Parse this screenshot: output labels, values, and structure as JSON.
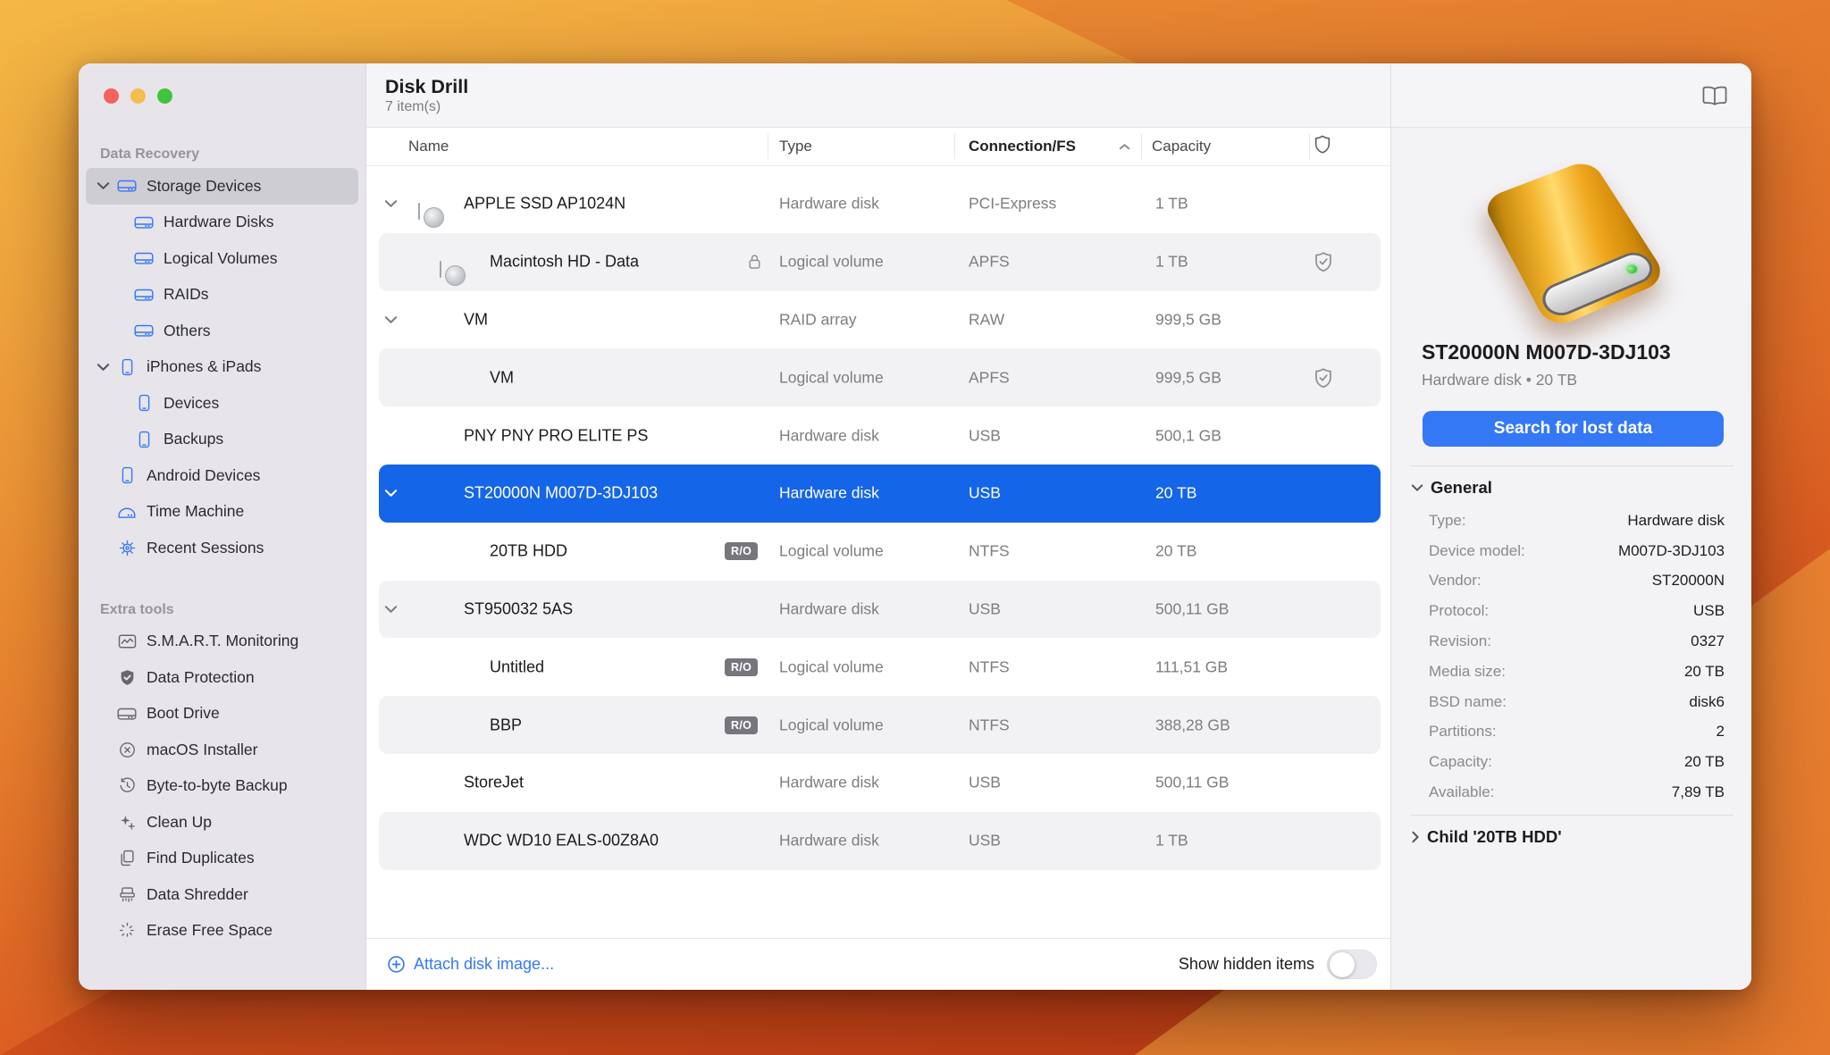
{
  "window": {
    "title": "Disk Drill",
    "subtitle": "7 item(s)"
  },
  "sidebar": {
    "sections": [
      {
        "label": "Data Recovery",
        "tone": "blue",
        "items": [
          {
            "label": "Storage Devices",
            "icon": "drive",
            "level": 0,
            "chevron": true,
            "selected": true
          },
          {
            "label": "Hardware Disks",
            "icon": "drive",
            "level": 1
          },
          {
            "label": "Logical Volumes",
            "icon": "drive",
            "level": 1
          },
          {
            "label": "RAIDs",
            "icon": "drive",
            "level": 1
          },
          {
            "label": "Others",
            "icon": "drive",
            "level": 1
          },
          {
            "label": "iPhones & iPads",
            "icon": "iphone",
            "level": 0,
            "chevron": true
          },
          {
            "label": "Devices",
            "icon": "iphone",
            "level": 1
          },
          {
            "label": "Backups",
            "icon": "iphone",
            "level": 1
          },
          {
            "label": "Android Devices",
            "icon": "iphone",
            "level": 0
          },
          {
            "label": "Time Machine",
            "icon": "timemachine",
            "level": 0
          },
          {
            "label": "Recent Sessions",
            "icon": "gear",
            "level": 0
          }
        ]
      },
      {
        "label": "Extra tools",
        "tone": "gray",
        "items": [
          {
            "label": "S.M.A.R.T. Monitoring",
            "icon": "smart",
            "level": 0
          },
          {
            "label": "Data Protection",
            "icon": "shield-filled",
            "level": 0
          },
          {
            "label": "Boot Drive",
            "icon": "drive",
            "level": 0
          },
          {
            "label": "macOS Installer",
            "icon": "circle-x",
            "level": 0
          },
          {
            "label": "Byte-to-byte Backup",
            "icon": "history",
            "level": 0
          },
          {
            "label": "Clean Up",
            "icon": "sparkle",
            "level": 0
          },
          {
            "label": "Find Duplicates",
            "icon": "duplicates",
            "level": 0
          },
          {
            "label": "Data Shredder",
            "icon": "shredder",
            "level": 0
          },
          {
            "label": "Erase Free Space",
            "icon": "erase",
            "level": 0
          }
        ]
      }
    ]
  },
  "table": {
    "columns": [
      "Name",
      "Type",
      "Connection/FS",
      "Capacity"
    ],
    "sort": {
      "column": "Connection/FS",
      "direction": "asc"
    },
    "rows": [
      {
        "name": "APPLE SSD AP1024N",
        "type": "Hardware disk",
        "connection": "PCI-Express",
        "capacity": "1 TB",
        "icon": "internal",
        "level": 0,
        "chevron": true
      },
      {
        "name": "Macintosh HD - Data",
        "type": "Logical volume",
        "connection": "APFS",
        "capacity": "1 TB",
        "icon": "internal",
        "level": 1,
        "lock": true,
        "shield": true
      },
      {
        "name": "VM",
        "type": "RAID array",
        "connection": "RAW",
        "capacity": "999,5 GB",
        "icon": "external",
        "level": 0,
        "chevron": true
      },
      {
        "name": "VM",
        "type": "Logical volume",
        "connection": "APFS",
        "capacity": "999,5 GB",
        "icon": "external",
        "level": 1,
        "shield": true
      },
      {
        "name": "PNY PNY PRO ELITE PS",
        "type": "Hardware disk",
        "connection": "USB",
        "capacity": "500,1 GB",
        "icon": "external",
        "level": 0
      },
      {
        "name": "ST20000N M007D-3DJ103",
        "type": "Hardware disk",
        "connection": "USB",
        "capacity": "20 TB",
        "icon": "external",
        "level": 0,
        "chevron": true,
        "selected": true
      },
      {
        "name": "20TB HDD",
        "type": "Logical volume",
        "connection": "NTFS",
        "capacity": "20 TB",
        "icon": "external",
        "level": 1,
        "ro": true
      },
      {
        "name": "ST950032 5AS",
        "type": "Hardware disk",
        "connection": "USB",
        "capacity": "500,11 GB",
        "icon": "external",
        "level": 0,
        "chevron": true
      },
      {
        "name": "Untitled",
        "type": "Logical volume",
        "connection": "NTFS",
        "capacity": "111,51 GB",
        "icon": "external",
        "level": 1,
        "ro": true
      },
      {
        "name": "BBP",
        "type": "Logical volume",
        "connection": "NTFS",
        "capacity": "388,28 GB",
        "icon": "external",
        "level": 1,
        "ro": true
      },
      {
        "name": "StoreJet",
        "type": "Hardware disk",
        "connection": "USB",
        "capacity": "500,11 GB",
        "icon": "external",
        "level": 0
      },
      {
        "name": "WDC WD10 EALS-00Z8A0",
        "type": "Hardware disk",
        "connection": "USB",
        "capacity": "1 TB",
        "icon": "external",
        "level": 0
      }
    ],
    "ro_badge": "R/O"
  },
  "footer": {
    "attach_label": "Attach disk image...",
    "show_hidden_label": "Show hidden items",
    "show_hidden_enabled": false
  },
  "inspector": {
    "title": "ST20000N M007D-3DJ103",
    "subtitle": "Hardware disk • 20 TB",
    "search_button": "Search for lost data",
    "general_label": "General",
    "details": [
      {
        "label": "Type:",
        "value": "Hardware disk"
      },
      {
        "label": "Device model:",
        "value": "M007D-3DJ103"
      },
      {
        "label": "Vendor:",
        "value": "ST20000N"
      },
      {
        "label": "Protocol:",
        "value": "USB"
      },
      {
        "label": "Revision:",
        "value": "0327"
      },
      {
        "label": "Media size:",
        "value": "20 TB"
      },
      {
        "label": "BSD name:",
        "value": "disk6"
      },
      {
        "label": "Partitions:",
        "value": "2"
      },
      {
        "label": "Capacity:",
        "value": "20 TB"
      },
      {
        "label": "Available:",
        "value": "7,89 TB"
      }
    ],
    "child_label": "Child '20TB HDD'"
  },
  "colors": {
    "accent-blue": "#3478F6",
    "selection-blue": "#1565E8",
    "traffic-red": "#F5615C",
    "traffic-yellow": "#F5BE4C",
    "traffic-green": "#3EC43F",
    "badge-gray": "#77767D",
    "disk-orange": "#EFA125"
  }
}
